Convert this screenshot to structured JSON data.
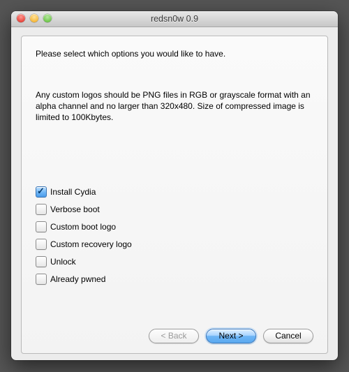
{
  "window": {
    "title": "redsn0w 0.9"
  },
  "intro": "Please select which options you would like to have.",
  "note": "Any custom logos should be PNG files in RGB or grayscale format with an alpha channel and no larger than 320x480. Size of compressed image is limited to 100Kbytes.",
  "options": [
    {
      "label": "Install Cydia",
      "checked": true
    },
    {
      "label": "Verbose boot",
      "checked": false
    },
    {
      "label": "Custom boot logo",
      "checked": false
    },
    {
      "label": "Custom recovery logo",
      "checked": false
    },
    {
      "label": "Unlock",
      "checked": false
    },
    {
      "label": "Already pwned",
      "checked": false
    }
  ],
  "buttons": {
    "back": "< Back",
    "next": "Next >",
    "cancel": "Cancel"
  }
}
